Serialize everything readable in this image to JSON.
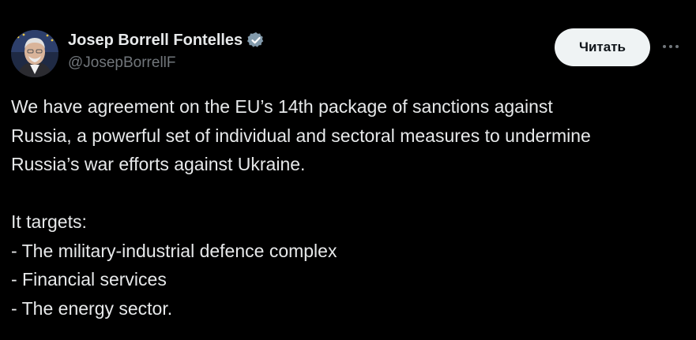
{
  "author": {
    "display_name": "Josep Borrell Fontelles",
    "handle": "@JosepBorrellF",
    "verified_badge": "verified-badge-icon",
    "badge_color": "#829aab"
  },
  "actions": {
    "follow_label": "Читать",
    "more_icon": "more-horizontal-icon"
  },
  "tweet": {
    "lines": [
      "We have agreement on the EU’s 14th package of sanctions against",
      "Russia, a powerful set of individual and sectoral measures to undermine",
      "Russia’s war efforts against Ukraine."
    ],
    "list_intro": "It targets:",
    "targets": [
      "- The military-industrial defence complex",
      "- Financial services",
      "- The energy sector."
    ]
  },
  "colors": {
    "background": "#000000",
    "text_primary": "#e7e9ea",
    "text_secondary": "#71767b",
    "button_bg": "#eff3f4",
    "button_text": "#0f1419"
  }
}
